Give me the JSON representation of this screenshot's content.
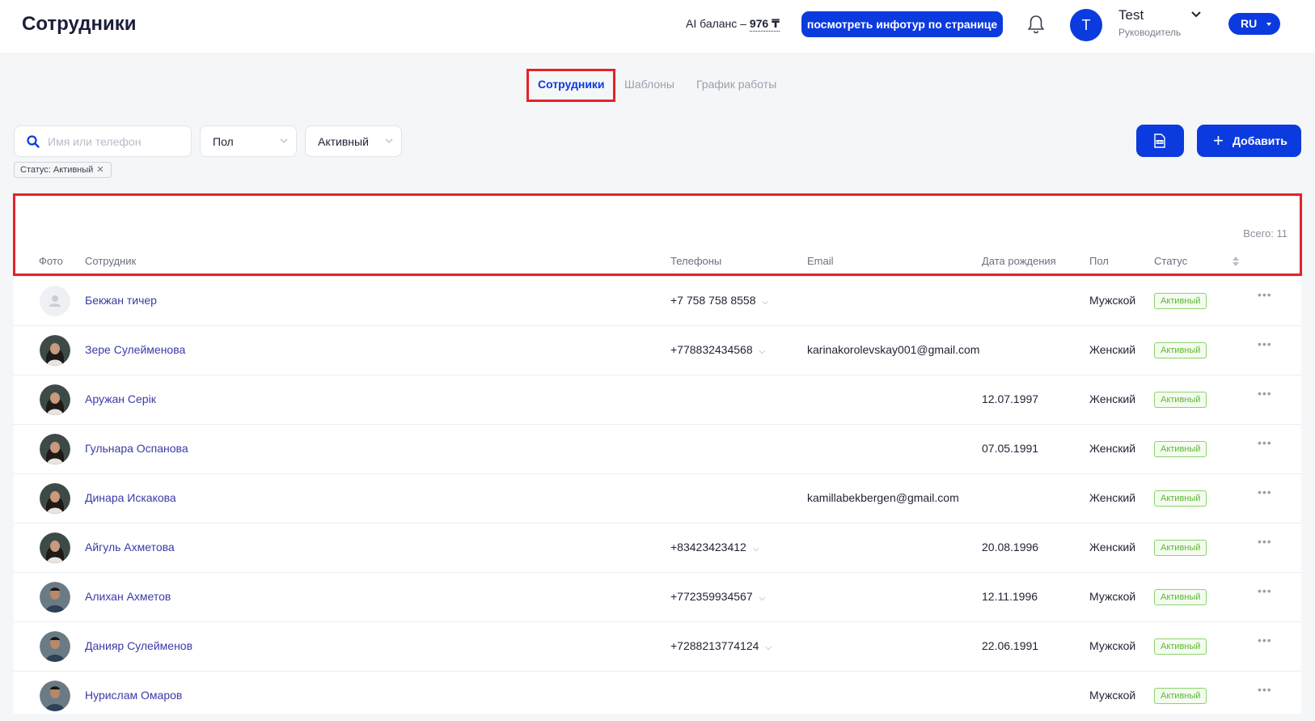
{
  "header": {
    "title": "Сотрудники",
    "ai_balance_label": "AI баланс –",
    "ai_balance_amount": "976 ₸",
    "tour_button": "посмотреть инфотур по странице",
    "user_initial": "T",
    "user_name": "Test",
    "user_role": "Руководитель",
    "language": "RU"
  },
  "tabs": [
    {
      "label": "Сотрудники",
      "active": true
    },
    {
      "label": "Шаблоны",
      "active": false
    },
    {
      "label": "График работы",
      "active": false
    }
  ],
  "filters": {
    "search_placeholder": "Имя или телефон",
    "gender_select": "Пол",
    "status_select": "Активный",
    "active_tag": "Статус: Активный",
    "add_button": "Добавить"
  },
  "table": {
    "total": "Всего: 11",
    "columns": [
      "Фото",
      "Сотрудник",
      "Телефоны",
      "Email",
      "Дата рождения",
      "Пол",
      "Статус"
    ],
    "rows": [
      {
        "name": "Бекжан тичер",
        "phone": "+7 758 758 8558",
        "email": "",
        "dob": "",
        "gender": "Мужской",
        "status": "Активный",
        "photo": "placeholder"
      },
      {
        "name": "Зере Сулейменова",
        "phone": "+778832434568",
        "email": "karinakorolevskay001@gmail.com",
        "dob": "",
        "gender": "Женский",
        "status": "Активный",
        "photo": "female"
      },
      {
        "name": "Аружан Серік",
        "phone": "",
        "email": "",
        "dob": "12.07.1997",
        "gender": "Женский",
        "status": "Активный",
        "photo": "female"
      },
      {
        "name": "Гульнара Оспанова",
        "phone": "",
        "email": "",
        "dob": "07.05.1991",
        "gender": "Женский",
        "status": "Активный",
        "photo": "female"
      },
      {
        "name": "Динара Искакова",
        "phone": "",
        "email": "kamillabekbergen@gmail.com",
        "dob": "",
        "gender": "Женский",
        "status": "Активный",
        "photo": "female"
      },
      {
        "name": "Айгуль Ахметова",
        "phone": "+83423423412",
        "email": "",
        "dob": "20.08.1996",
        "gender": "Женский",
        "status": "Активный",
        "photo": "female"
      },
      {
        "name": "Алихан Ахметов",
        "phone": "+772359934567",
        "email": "",
        "dob": "12.11.1996",
        "gender": "Мужской",
        "status": "Активный",
        "photo": "male"
      },
      {
        "name": "Данияр Сулейменов",
        "phone": "+7288213774124",
        "email": "",
        "dob": "22.06.1991",
        "gender": "Мужской",
        "status": "Активный",
        "photo": "male"
      },
      {
        "name": "Нурислам Омаров",
        "phone": "",
        "email": "",
        "dob": "",
        "gender": "Мужской",
        "status": "Активный",
        "photo": "male"
      }
    ]
  },
  "colors": {
    "accent": "#0b3bde",
    "highlight": "#e3232a",
    "status_green": "#5cb836"
  }
}
